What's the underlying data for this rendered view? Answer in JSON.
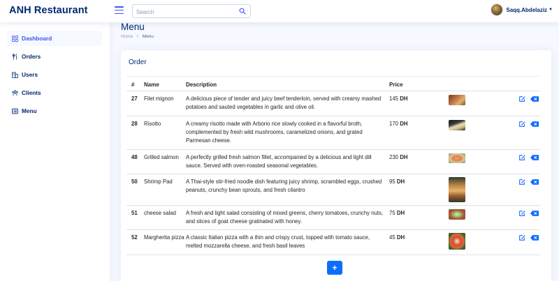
{
  "header": {
    "logo": "ANH Restaurant",
    "search_placeholder": "Search",
    "user_name": "Saqq.Abdelaziz",
    "accent": "#4154f1"
  },
  "sidebar": {
    "items": [
      {
        "label": "Dashboard",
        "icon": "grid-icon",
        "active": true
      },
      {
        "label": "Orders",
        "icon": "utensils-icon"
      },
      {
        "label": "Users",
        "icon": "building-icon"
      },
      {
        "label": "Clients",
        "icon": "people-icon"
      },
      {
        "label": "Menu",
        "icon": "list-icon"
      }
    ]
  },
  "page": {
    "title": "Menu",
    "breadcrumb": [
      "Home",
      "/",
      "Menu"
    ]
  },
  "card": {
    "title": "Order",
    "columns": [
      "#",
      "Name",
      "Description",
      "Price"
    ],
    "rows": [
      {
        "id": "27",
        "name": "Filet mignon",
        "description": "A delicious piece of tender and juicy beef tenderloin, served with creamy mashed potatoes and sauted vegetables in garlic and olive oil.",
        "price": "145",
        "currency": "DH"
      },
      {
        "id": "28",
        "name": "Risotto",
        "description": "A creamy risotto made with Arborio rice slowly cooked in a flavorful broth, complemented by fresh wild mushrooms, caramelized onions, and grated Parmesan cheese.",
        "price": "170",
        "currency": "DH"
      },
      {
        "id": "48",
        "name": "Grilled salmon",
        "description": "A perfectly grilled fresh salmon fillet, accompanied by a delicious and light dill sauce. Served with oven-roasted seasonal vegetables.",
        "price": "230",
        "currency": "DH"
      },
      {
        "id": "50",
        "name": "Shrimp Pad",
        "description": "A Thai-style stir-fried noodle dish featuring juicy shrimp, scrambled eggs, crushed peanuts, crunchy bean sprouts, and fresh cilantro",
        "price": "95",
        "currency": "DH"
      },
      {
        "id": "51",
        "name": "cheese salad",
        "description": "A fresh and light salad consisting of mixed greens, cherry tomatoes, crunchy nuts, and slices of goat cheese gratinated with honey.",
        "price": "75",
        "currency": "DH"
      },
      {
        "id": "52",
        "name": "Margherita pizza",
        "description": "A classic Italian pizza with a thin and crispy crust, topped with tomato sauce, melted mozzarella cheese, and fresh basil leaves",
        "price": "45",
        "currency": "DH"
      }
    ],
    "add_label": "+"
  }
}
